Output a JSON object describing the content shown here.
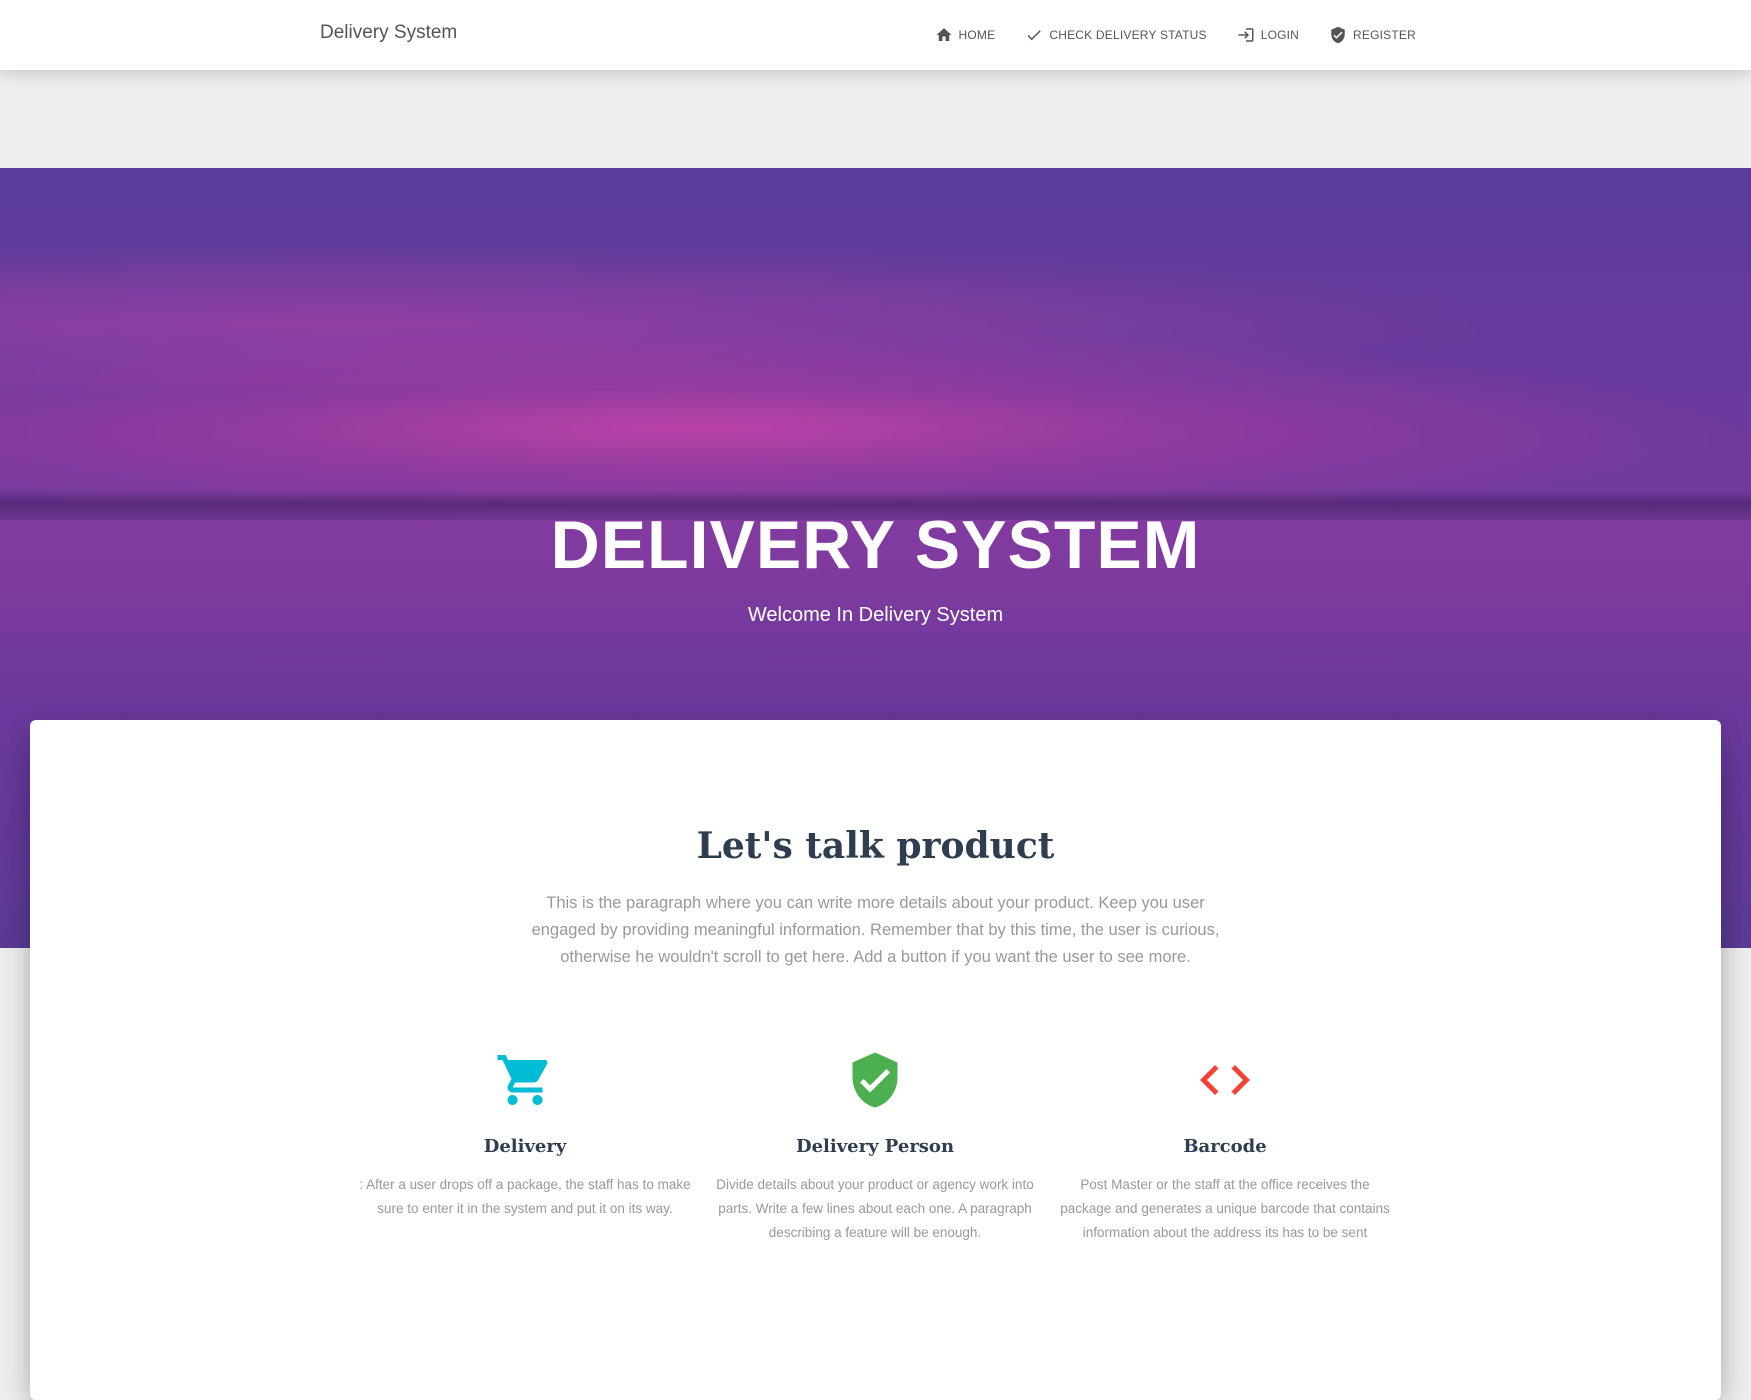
{
  "navbar": {
    "brand": "Delivery System",
    "links": [
      {
        "label": "Home",
        "icon": "home-icon"
      },
      {
        "label": "Check Delivery Status",
        "icon": "check-icon"
      },
      {
        "label": "Login",
        "icon": "login-icon"
      },
      {
        "label": "Register",
        "icon": "shield-check-icon"
      }
    ]
  },
  "hero": {
    "title": "DELIVERY SYSTEM",
    "subtitle": "Welcome In Delivery System"
  },
  "product": {
    "title": "Let's talk product",
    "description": "This is the paragraph where you can write more details about your product. Keep you user engaged by providing meaningful information. Remember that by this time, the user is curious, otherwise he wouldn't scroll to get here. Add a button if you want the user to see more.",
    "features": [
      {
        "title": "Delivery",
        "text": ": After a user drops off a package, the staff has to make sure to enter it in the system and put it on its way.",
        "icon": "shopping-cart-icon",
        "color": "#00bcd4"
      },
      {
        "title": "Delivery Person",
        "text": "Divide details about your product or agency work into parts. Write a few lines about each one. A paragraph describing a feature will be enough.",
        "icon": "verified-shield-icon",
        "color": "#4caf50"
      },
      {
        "title": "Barcode",
        "text": "Post Master or the staff at the office receives the package and generates a unique barcode that contains information about the address its has to be sent",
        "icon": "code-icon",
        "color": "#f44336"
      }
    ]
  }
}
